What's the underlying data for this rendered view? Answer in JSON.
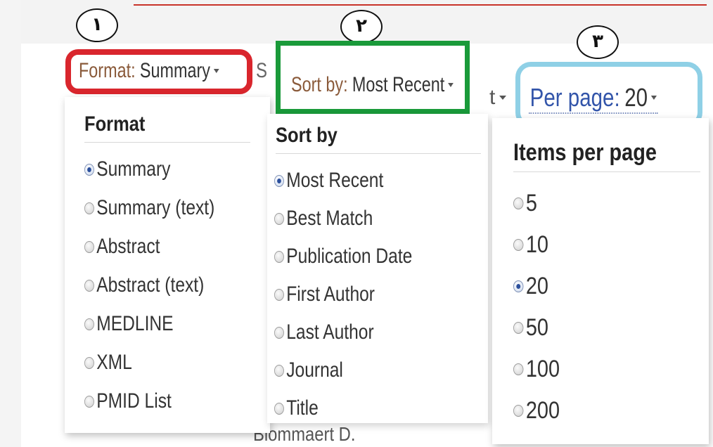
{
  "markers": [
    "١",
    "٢",
    "٣"
  ],
  "format": {
    "trigger_label": "Format:",
    "trigger_value": "Summary",
    "heading": "Format",
    "options": [
      "Summary",
      "Summary (text)",
      "Abstract",
      "Abstract (text)",
      "MEDLINE",
      "XML",
      "PMID List"
    ],
    "selected": "Summary",
    "highlight_color": "#d9262d"
  },
  "sort": {
    "trigger_label": "Sort by:",
    "trigger_value": "Most Recent",
    "heading": "Sort by",
    "options": [
      "Most Recent",
      "Best Match",
      "Publication Date",
      "First Author",
      "Last Author",
      "Journal",
      "Title"
    ],
    "selected": "Most Recent",
    "highlight_color": "#1a9a3a"
  },
  "perpage": {
    "trigger_label": "Per page:",
    "trigger_value": "20",
    "heading": "Items per page",
    "options": [
      "5",
      "10",
      "20",
      "50",
      "100",
      "200"
    ],
    "selected": "20",
    "highlight_color": "#8fd0e6"
  },
  "fragments": {
    "partial_s": "S",
    "partial_t": "t",
    "partial_bottom": "Blommaert D."
  },
  "colors": {
    "label_brown": "#8a5a3a",
    "label_blue": "#3355aa",
    "text": "#333333"
  }
}
